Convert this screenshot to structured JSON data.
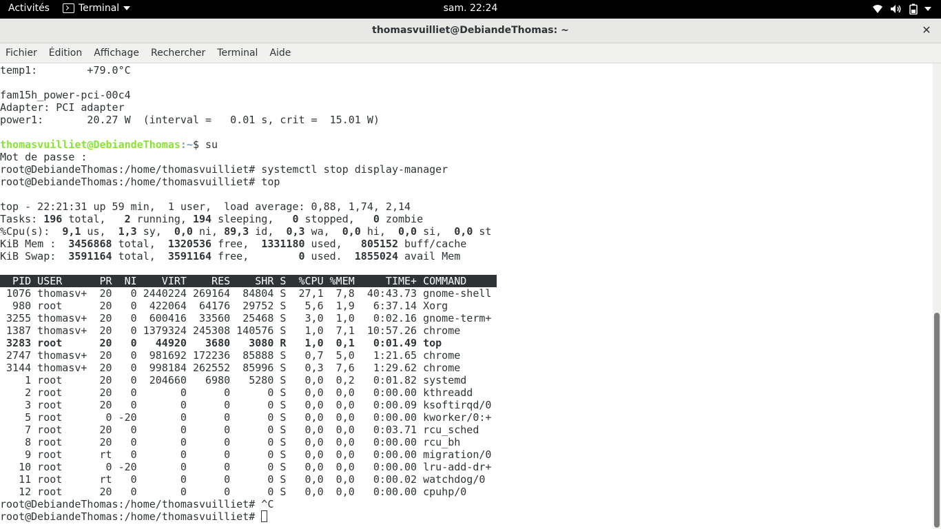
{
  "topbar": {
    "activities": "Activités",
    "app_name": "Terminal",
    "clock": "sam. 22:24",
    "icons": [
      "wifi-icon",
      "volume-icon",
      "battery-icon",
      "system-menu-caret-icon"
    ]
  },
  "window": {
    "title": "thomasvuilliet@DebiandeThomas: ~",
    "close_symbol": "✕"
  },
  "menubar": {
    "items": [
      "Fichier",
      "Édition",
      "Affichage",
      "Rechercher",
      "Terminal",
      "Aide"
    ]
  },
  "terminal": {
    "before_top": [
      "temp1:        +79.0°C",
      "",
      "fam15h_power-pci-00c4",
      "Adapter: PCI adapter",
      "power1:       20.27 W  (interval =   0.01 s, crit =  15.01 W)",
      ""
    ],
    "prompt_user": "thomasvuilliet@DebiandeThomas",
    "prompt_path": ":~",
    "prompt_cmd": "$ su",
    "after_su": [
      "Mot de passe :",
      "root@DebiandeThomas:/home/thomasvuilliet# systemctl stop display-manager",
      "root@DebiandeThomas:/home/thomasvuilliet# top",
      ""
    ],
    "summary": [
      "top - 22:21:31 up 59 min,  1 user,  load average: 0,88, 1,74, 2,14",
      "Tasks: **196** total,   **2** running, **194** sleeping,   **0** stopped,   **0** zombie",
      "%Cpu(s):  **9,1** us,  **1,3** sy,  **0,0** ni, **89,3** id,  **0,3** wa,  **0,0** hi,  **0,0** si,  **0,0** st",
      "KiB Mem :  **3456868** total,  **1320536** free,  **1331180** used,   **805152** buff/cache",
      "KiB Swap:  **3591164** total,  **3591164** free,        **0** used.  **1855024** avail Mem",
      ""
    ],
    "table_header": "  PID USER      PR  NI    VIRT    RES    SHR S  %CPU %MEM     TIME+ COMMAND   ",
    "processes": [
      {
        "text": " 1076 thomasv+  20   0 2440224 269164  84804 S  27,1  7,8  40:43.73 gnome-shell",
        "bold": false
      },
      {
        "text": "  980 root      20   0  422064  64176  29752 S   5,6  1,9   6:37.14 Xorg",
        "bold": false
      },
      {
        "text": " 3255 thomasv+  20   0  600416  33560  25468 S   3,0  1,0   0:02.16 gnome-term+",
        "bold": false
      },
      {
        "text": " 1387 thomasv+  20   0 1379324 245308 140576 S   1,0  7,1  10:57.26 chrome",
        "bold": false
      },
      {
        "text": " 3283 root      20   0   44920   3680   3080 R   1,0  0,1   0:01.49 top",
        "bold": true
      },
      {
        "text": " 2747 thomasv+  20   0  981692 172236  85888 S   0,7  5,0   1:21.65 chrome",
        "bold": false
      },
      {
        "text": " 3144 thomasv+  20   0  998184 262552  85996 S   0,3  7,6   1:29.62 chrome",
        "bold": false
      },
      {
        "text": "    1 root      20   0  204660   6980   5280 S   0,0  0,2   0:01.82 systemd",
        "bold": false
      },
      {
        "text": "    2 root      20   0       0      0      0 S   0,0  0,0   0:00.00 kthreadd",
        "bold": false
      },
      {
        "text": "    3 root      20   0       0      0      0 S   0,0  0,0   0:00.09 ksoftirqd/0",
        "bold": false
      },
      {
        "text": "    5 root       0 -20       0      0      0 S   0,0  0,0   0:00.00 kworker/0:+",
        "bold": false
      },
      {
        "text": "    7 root      20   0       0      0      0 S   0,0  0,0   0:03.71 rcu_sched",
        "bold": false
      },
      {
        "text": "    8 root      20   0       0      0      0 S   0,0  0,0   0:00.00 rcu_bh",
        "bold": false
      },
      {
        "text": "    9 root      rt   0       0      0      0 S   0,0  0,0   0:00.00 migration/0",
        "bold": false
      },
      {
        "text": "   10 root       0 -20       0      0      0 S   0,0  0,0   0:00.00 lru-add-dr+",
        "bold": false
      },
      {
        "text": "   11 root      rt   0       0      0      0 S   0,0  0,0   0:00.02 watchdog/0",
        "bold": false
      },
      {
        "text": "   12 root      20   0       0      0      0 S   0,0  0,0   0:00.00 cpuhp/0",
        "bold": false
      }
    ],
    "after_top": [
      "root@DebiandeThomas:/home/thomasvuilliet# ^C"
    ],
    "final_prompt": "root@DebiandeThomas:/home/thomasvuilliet# "
  },
  "colors": {
    "prompt_user": "#8ae234",
    "prompt_path": "#729fcf",
    "header_bg": "#2e3436",
    "text": "#2e3436"
  }
}
